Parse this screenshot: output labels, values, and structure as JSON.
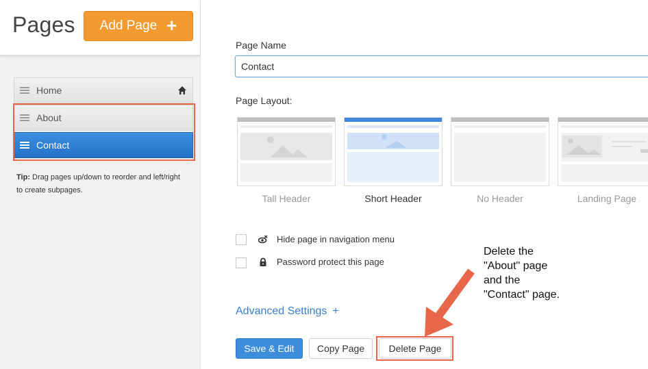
{
  "sidebar": {
    "title": "Pages",
    "add_button_label": "Add Page",
    "add_button_icon": "plus-icon",
    "items": [
      {
        "label": "Home",
        "icon": "home-icon"
      },
      {
        "label": "About"
      },
      {
        "label": "Contact",
        "active": true
      }
    ],
    "tip_bold": "Tip:",
    "tip_text": " Drag pages up/down to reorder and left/right to create subpages."
  },
  "form": {
    "page_name_label": "Page Name",
    "page_name_value": "Contact",
    "page_layout_label": "Page Layout:",
    "layouts": [
      {
        "name": "Tall Header"
      },
      {
        "name": "Short Header",
        "selected": true
      },
      {
        "name": "No Header"
      },
      {
        "name": "Landing Page"
      }
    ],
    "options": [
      {
        "label": "Hide page in navigation menu",
        "icon": "hidden-eye-icon",
        "checked": false
      },
      {
        "label": "Password protect this page",
        "icon": "lock-icon",
        "checked": false
      }
    ],
    "advanced_label": "Advanced Settings",
    "advanced_icon": "+"
  },
  "actions": {
    "save_label": "Save & Edit",
    "copy_label": "Copy Page",
    "delete_label": "Delete Page"
  },
  "annotation": {
    "lines": [
      "Delete the",
      "\"About\" page",
      "and the",
      "\"Contact\" page."
    ],
    "highlight_color": "#e8664a"
  },
  "colors": {
    "accent_orange": "#f39a30",
    "primary_blue": "#3d8ddb",
    "link_blue": "#3a7fd0"
  }
}
